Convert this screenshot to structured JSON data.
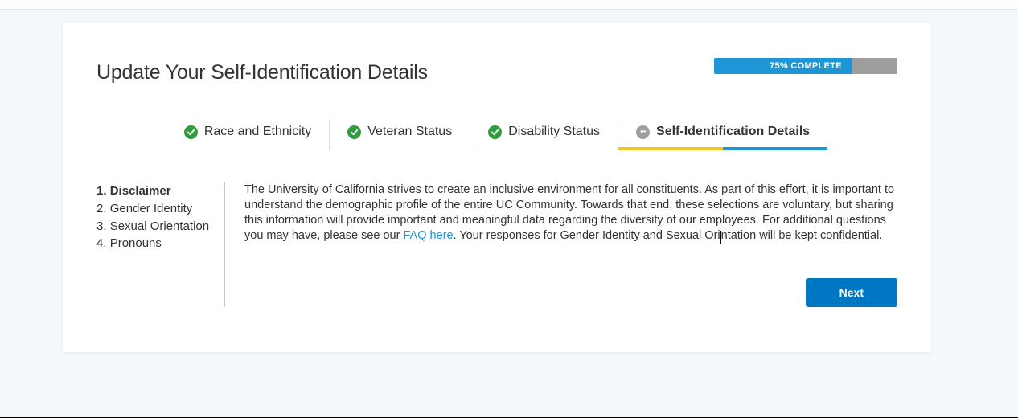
{
  "header": {
    "title": "Update Your Self-Identification Details"
  },
  "progress": {
    "percent": 75,
    "label": "75% COMPLETE"
  },
  "tabs": [
    {
      "label": "Race and Ethnicity",
      "state": "done"
    },
    {
      "label": "Veteran Status",
      "state": "done"
    },
    {
      "label": "Disability Status",
      "state": "done"
    },
    {
      "label": "Self-Identification Details",
      "state": "active"
    }
  ],
  "sidebar": {
    "items": [
      {
        "label": "Disclaimer",
        "active": true
      },
      {
        "label": "Gender Identity",
        "active": false
      },
      {
        "label": "Sexual Orientation",
        "active": false
      },
      {
        "label": "Pronouns",
        "active": false
      }
    ]
  },
  "content": {
    "body_a": "The University of California strives to create an inclusive environment for all constituents. As part of this effort, it is important to understand the demographic profile of the entire UC Community. Towards that end, these selections are voluntary, but sharing this information will provide important and meaningful data regarding the diversity of our employees. For additional questions you may have, please see our ",
    "faq_text": "FAQ here",
    "body_b": ". Your responses for Gender Identity and Sexual Ori",
    "body_c": "ntation will be kept confidential."
  },
  "buttons": {
    "next": "Next"
  }
}
